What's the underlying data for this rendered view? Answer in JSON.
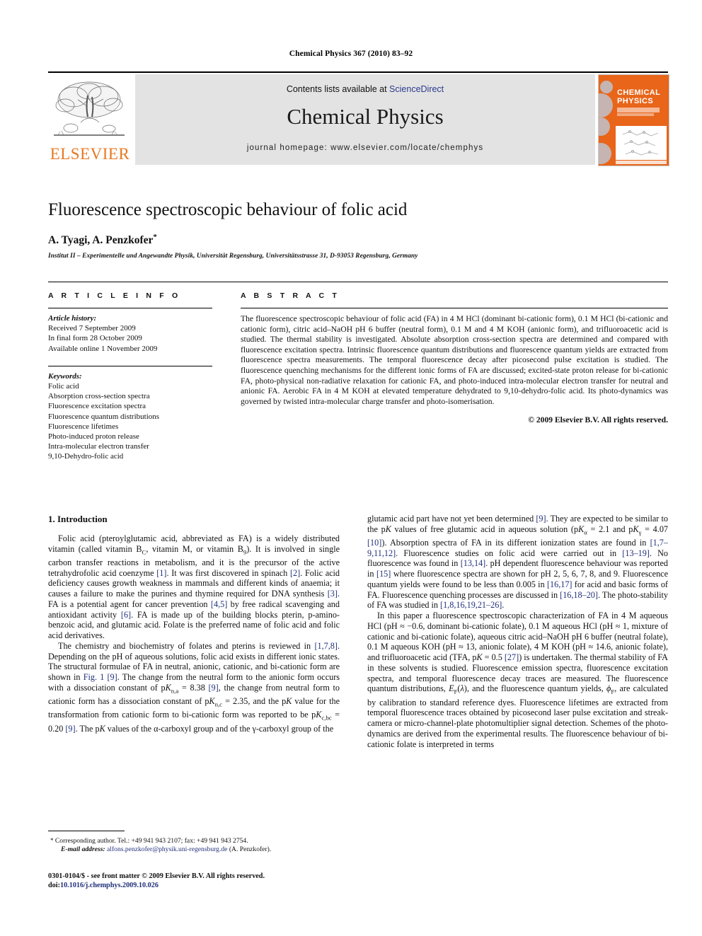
{
  "running_head": "Chemical Physics 367 (2010) 83–92",
  "masthead": {
    "contents_text": "Contents lists available at ",
    "sciencedirect": "ScienceDirect",
    "journal_title": "Chemical Physics",
    "homepage": "journal homepage: www.elsevier.com/locate/chemphys",
    "publisher_wordmark": "ELSEVIER",
    "cover_title_line1": "CHEMICAL",
    "cover_title_line2": "PHYSICS",
    "accent_color": "#E87722",
    "link_color": "#2b3a8f"
  },
  "article": {
    "title": "Fluorescence spectroscopic behaviour of folic acid",
    "authors": "A. Tyagi, A. Penzkofer",
    "corresponding_marker": "*",
    "affiliation": "Institut II – Experimentelle und Angewandte Physik, Universität Regensburg, Universitätsstrasse 31, D-93053 Regensburg, Germany"
  },
  "article_info": {
    "heading": "A R T I C L E  I N F O",
    "history_label": "Article history:",
    "history": [
      "Received 7 September 2009",
      "In final form 28 October 2009",
      "Available online 1 November 2009"
    ],
    "keywords_label": "Keywords:",
    "keywords": [
      "Folic acid",
      "Absorption cross-section spectra",
      "Fluorescence excitation spectra",
      "Fluorescence quantum distributions",
      "Fluorescence lifetimes",
      "Photo-induced proton release",
      "Intra-molecular electron transfer",
      "9,10-Dehydro-folic acid"
    ]
  },
  "abstract": {
    "heading": "A B S T R A C T",
    "text": "The fluorescence spectroscopic behaviour of folic acid (FA) in 4 M HCl (dominant bi-cationic form), 0.1 M HCl (bi-cationic and cationic form), citric acid–NaOH pH 6 buffer (neutral form), 0.1 M and 4 M KOH (anionic form), and trifluoroacetic acid is studied. The thermal stability is investigated. Absolute absorption cross-section spectra are determined and compared with fluorescence excitation spectra. Intrinsic fluorescence quantum distributions and fluorescence quantum yields are extracted from fluorescence spectra measurements. The temporal fluorescence decay after picosecond pulse excitation is studied. The fluorescence quenching mechanisms for the different ionic forms of FA are discussed; excited-state proton release for bi-cationic FA, photo-physical non-radiative relaxation for cationic FA, and photo-induced intra-molecular electron transfer for neutral and anionic FA. Aerobic FA in 4 M KOH at elevated temperature dehydrated to 9,10-dehydro-folic acid. Its photo-dynamics was governed by twisted intra-molecular charge transfer and photo-isomerisation.",
    "copyright": "© 2009 Elsevier B.V. All rights reserved."
  },
  "body": {
    "section_title": "1. Introduction",
    "left_paragraphs": [
      "Folic acid (pteroylglutamic acid, abbreviated as FA) is a widely distributed vitamin (called vitamin B<sub>C</sub>, vitamin M, or vitamin B<sub>9</sub>). It is involved in single carbon transfer reactions in metabolism, and it is the precursor of the active tetrahydrofolic acid coenzyme <span class=\"ref\">[1]</span>. It was first discovered in spinach <span class=\"ref\">[2]</span>. Folic acid deficiency causes growth weakness in mammals and different kinds of anaemia; it causes a failure to make the purines and thymine required for DNA synthesis <span class=\"ref\">[3]</span>. FA is a potential agent for cancer prevention <span class=\"ref\">[4,5]</span> by free radical scavenging and antioxidant activity <span class=\"ref\">[6]</span>. FA is made up of the building blocks pterin, p-amino-benzoic acid, and glutamic acid. Folate is the preferred name of folic acid and folic acid derivatives.",
      "The chemistry and biochemistry of folates and pterins is reviewed in <span class=\"ref\">[1,7,8]</span>. Depending on the pH of aqueous solutions, folic acid exists in different ionic states. The structural formulae of FA in neutral, anionic, cationic, and bi-cationic form are shown in <span class=\"ref\">Fig. 1</span> <span class=\"ref\">[9]</span>. The change from the neutral form to the anionic form occurs with a dissociation constant of p<span class=\"ital\">K</span><sub>n,a</sub> = 8.38 <span class=\"ref\">[9]</span>, the change from neutral form to cationic form has a dissociation constant of p<span class=\"ital\">K</span><sub>n,c</sub> = 2.35, and the p<span class=\"ital\">K</span> value for the transformation from cationic form to bi-cationic form was reported to be p<span class=\"ital\">K</span><sub>c,bc</sub> = 0.20 <span class=\"ref\">[9]</span>. The p<span class=\"ital\">K</span> values of the α-carboxyl group and of the γ-carboxyl group of the"
    ],
    "right_paragraphs": [
      "glutamic acid part have not yet been determined <span class=\"ref\">[9]</span>. They are expected to be similar to the p<span class=\"ital\">K</span> values of free glutamic acid in aqueous solution (p<span class=\"ital\">K</span><sub>α</sub> = 2.1 and p<span class=\"ital\">K</span><sub>γ</sub> = 4.07 <span class=\"ref\">[10]</span>). Absorption spectra of FA in its different ionization states are found in <span class=\"ref\">[1,7–9,11,12]</span>. Fluorescence studies on folic acid were carried out in <span class=\"ref\">[13–19]</span>. No fluorescence was found in <span class=\"ref\">[13,14]</span>. pH dependent fluorescence behaviour was reported in <span class=\"ref\">[15]</span> where fluorescence spectra are shown for pH 2, 5, 6, 7, 8, and 9. Fluorescence quantum yields were found to be less than 0.005 in <span class=\"ref\">[16,17]</span> for acid and basic forms of FA. Fluorescence quenching processes are discussed in <span class=\"ref\">[16,18–20]</span>. The photo-stability of FA was studied in <span class=\"ref\">[1,8,16,19,21–26]</span>.",
      "In this paper a fluorescence spectroscopic characterization of FA in 4 M aqueous HCl (pH ≈ −0.6, dominant bi-cationic folate), 0.1 M aqueous HCl (pH ≈ 1, mixture of cationic and bi-cationic folate), aqueous citric acid–NaOH pH 6 buffer (neutral folate), 0.1 M aqueous KOH (pH ≈ 13, anionic folate), 4 M KOH (pH ≈ 14.6, anionic folate), and trifluoroacetic acid (TFA, p<span class=\"ital\">K</span> = 0.5 <span class=\"ref\">[27]</span>) is undertaken. The thermal stability of FA in these solvents is studied. Fluorescence emission spectra, fluorescence excitation spectra, and temporal fluorescence decay traces are measured. The fluorescence quantum distributions, <span class=\"ital\">E</span><sub>F</sub>(<span class=\"ital\">λ</span>), and the fluorescence quantum yields, <span class=\"ital\">ϕ</span><sub>F</sub>, are calculated by calibration to standard reference dyes. Fluorescence lifetimes are extracted from temporal fluorescence traces obtained by picosecond laser pulse excitation and streak-camera or micro-channel-plate photomultiplier signal detection. Schemes of the photo-dynamics are derived from the experimental results. The fluorescence behaviour of bi-cationic folate is interpreted in terms"
    ]
  },
  "footnote": {
    "marker": "*",
    "corresponding": "Corresponding author. Tel.: +49 941 943 2107; fax: +49 941 943 2754.",
    "email_label": "E-mail address:",
    "email": "alfons.penzkofer@physik.uni-regensburg.de",
    "email_owner": "(A. Penzkofer)."
  },
  "page_footer": {
    "issn_line": "0301-0104/$ - see front matter © 2009 Elsevier B.V. All rights reserved.",
    "doi_label": "doi:",
    "doi": "10.1016/j.chemphys.2009.10.026"
  }
}
